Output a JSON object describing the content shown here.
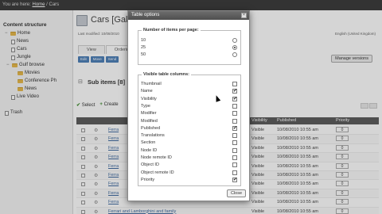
{
  "topbar": {
    "prefix": "You are here:",
    "home": "Home",
    "sep": " / ",
    "current": "Cars"
  },
  "sidebar": {
    "heading": "Content structure",
    "items": [
      {
        "label": "Home",
        "level": 0
      },
      {
        "label": "News",
        "level": 1
      },
      {
        "label": "Cars",
        "level": 1
      },
      {
        "label": "Jungle",
        "level": 1
      },
      {
        "label": "Gulf browse",
        "level": 1
      },
      {
        "label": "Movies",
        "level": 2
      },
      {
        "label": "Conference Ph",
        "level": 2
      },
      {
        "label": "News",
        "level": 2
      },
      {
        "label": "Live Video",
        "level": 1
      },
      {
        "label": "Trash",
        "level": 0
      }
    ]
  },
  "header": {
    "title": "Cars [Gall",
    "modified": "Last modified: 10/08/2010",
    "language": "English (United Kingdom)",
    "tabs": [
      "View",
      "Ordering",
      "S"
    ],
    "actions": [
      "Edit",
      "Move",
      "Send"
    ],
    "manage_versions": "Manage versions"
  },
  "subitems": {
    "title": "Sub items [8]",
    "select": "Select",
    "create": "Create"
  },
  "table": {
    "columns": {
      "visibility": "Visibility",
      "published": "Published",
      "priority": "Priority"
    },
    "rows": [
      {
        "name": "Ferra",
        "visibility": "Visible",
        "published": "10/08/2010 10:55 am",
        "priority": "0"
      },
      {
        "name": "Ferra",
        "visibility": "Visible",
        "published": "10/08/2010 10:55 am",
        "priority": "0"
      },
      {
        "name": "Ferra",
        "visibility": "Visible",
        "published": "10/08/2010 10:55 am",
        "priority": "0"
      },
      {
        "name": "Ferra",
        "visibility": "Visible",
        "published": "10/08/2010 10:55 am",
        "priority": "0"
      },
      {
        "name": "Ferra",
        "visibility": "Visible",
        "published": "10/08/2010 10:55 am",
        "priority": "0"
      },
      {
        "name": "Ferra",
        "visibility": "Visible",
        "published": "10/08/2010 10:55 am",
        "priority": "0"
      },
      {
        "name": "Ferra",
        "visibility": "Visible",
        "published": "10/08/2010 10:55 am",
        "priority": "0"
      },
      {
        "name": "Ferra",
        "visibility": "Visible",
        "published": "10/08/2010 10:55 am",
        "priority": "0"
      },
      {
        "name": "Ferra",
        "visibility": "Visible",
        "published": "10/08/2010 10:55 am",
        "priority": "0"
      },
      {
        "name": "Ferrari and Lamborghini and family",
        "visibility": "Visible",
        "published": "10/08/2010 10:55 am",
        "priority": "0"
      }
    ]
  },
  "dialog": {
    "title": "Table options",
    "items_per_page_legend": "Number of items per page:",
    "items_per_page": [
      {
        "label": "10",
        "selected": false
      },
      {
        "label": "25",
        "selected": true
      },
      {
        "label": "50",
        "selected": false
      }
    ],
    "columns_legend": "Visible table columns:",
    "columns": [
      {
        "label": "Thumbnail",
        "checked": false
      },
      {
        "label": "Name",
        "checked": true
      },
      {
        "label": "Visibility",
        "checked": true
      },
      {
        "label": "Type",
        "checked": false
      },
      {
        "label": "Modifier",
        "checked": false
      },
      {
        "label": "Modified",
        "checked": false
      },
      {
        "label": "Published",
        "checked": true
      },
      {
        "label": "Translations",
        "checked": false
      },
      {
        "label": "Section",
        "checked": false
      },
      {
        "label": "Node ID",
        "checked": false
      },
      {
        "label": "Node remote ID",
        "checked": false
      },
      {
        "label": "Object ID",
        "checked": false
      },
      {
        "label": "Object remote ID",
        "checked": false
      },
      {
        "label": "Priority",
        "checked": true
      }
    ],
    "close_label": "Close",
    "check_glyph": "✔"
  }
}
